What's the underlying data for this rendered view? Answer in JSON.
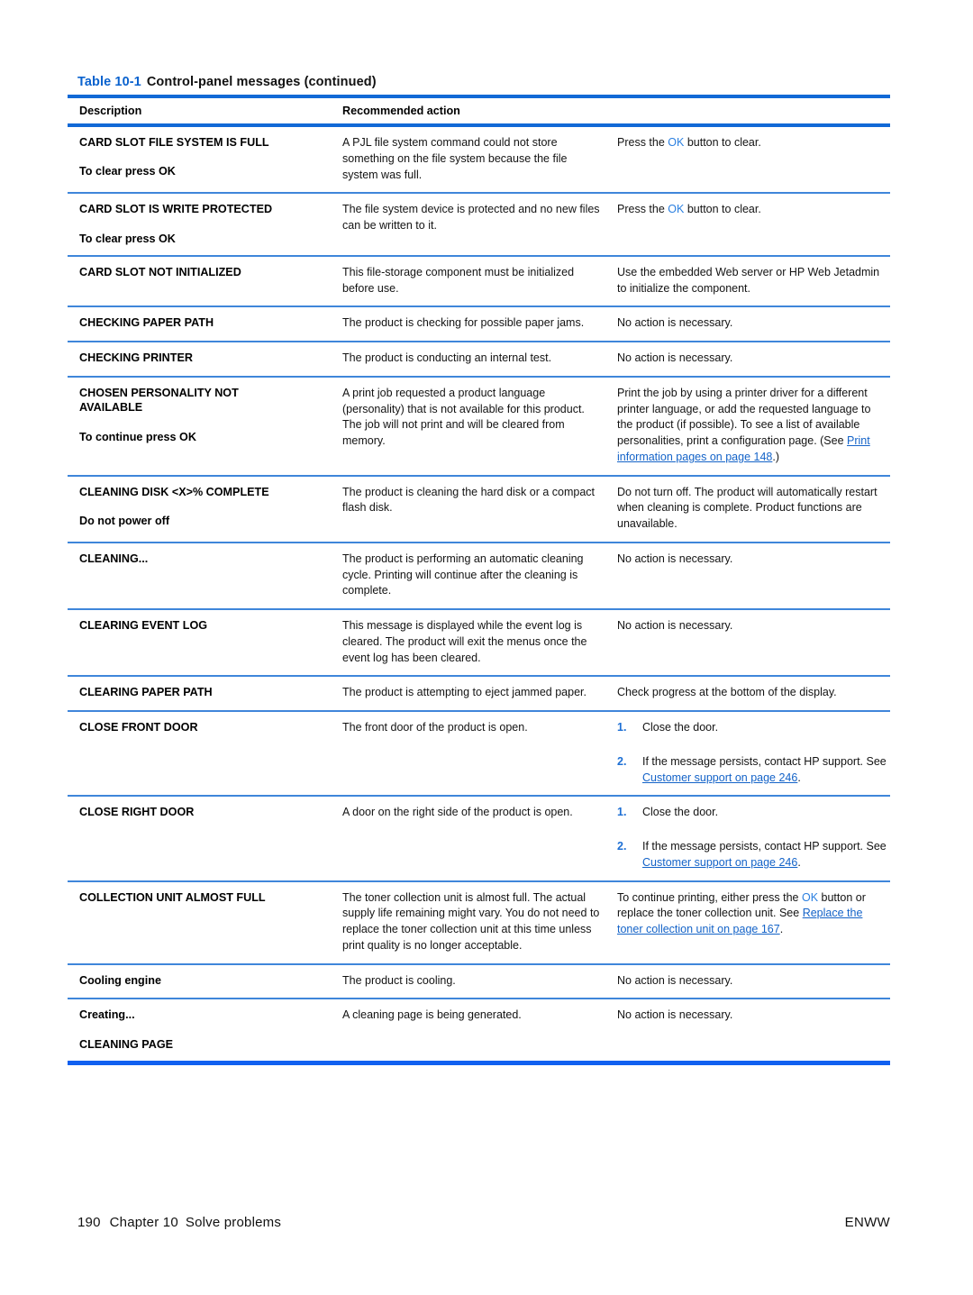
{
  "caption": {
    "label": "Table 10-1",
    "title": "Control-panel messages (continued)"
  },
  "table": {
    "headers": {
      "col1": "Description",
      "col2": "Recommended action"
    },
    "rows": [
      {
        "term": "CARD SLOT FILE SYSTEM IS FULL",
        "subterm": "To clear press OK",
        "description": "A PJL file system command could not store something on the file system because the file system was full.",
        "action_pre": "Press the ",
        "action_ok": "OK",
        "action_post": " button to clear."
      },
      {
        "term": "CARD SLOT IS WRITE PROTECTED",
        "subterm": "To clear press OK",
        "description": "The file system device is protected and no new files can be written to it.",
        "action_pre": "Press the ",
        "action_ok": "OK",
        "action_post": " button to clear."
      },
      {
        "term": "CARD SLOT NOT INITIALIZED",
        "subterm": "",
        "description": "This file-storage component must be initialized before use.",
        "action": "Use the embedded Web server or HP Web Jetadmin to initialize the component."
      },
      {
        "term": "CHECKING PAPER PATH",
        "subterm": "",
        "description": "The product is checking for possible paper jams.",
        "action": "No action is necessary."
      },
      {
        "term": "CHECKING PRINTER",
        "subterm": "",
        "description": "The product is conducting an internal test.",
        "action": "No action is necessary."
      },
      {
        "term": "CHOSEN PERSONALITY NOT AVAILABLE",
        "subterm": "To continue press OK",
        "description": "A print job requested a product language (personality) that is not available for this product. The job will not print and will be cleared from memory.",
        "action_pre": "Print the job by using a printer driver for a different printer language, or add the requested language to the product (if possible). To see a list of available personalities, print a configuration page. (See ",
        "action_link": "Print information pages on page 148",
        "action_post": ".)"
      },
      {
        "term": "CLEANING DISK <X>% COMPLETE",
        "subterm": "Do not power off",
        "description": "The product is cleaning the hard disk or a compact flash disk.",
        "action": "Do not turn off. The product will automatically restart when cleaning is complete. Product functions are unavailable."
      },
      {
        "term": "CLEANING...",
        "subterm": "",
        "description": "The product is performing an automatic cleaning cycle. Printing will continue after the cleaning is complete.",
        "action": "No action is necessary."
      },
      {
        "term": "CLEARING EVENT LOG",
        "subterm": "",
        "description": "This message is displayed while the event log is cleared. The product will exit the menus once the event log has been cleared.",
        "action": "No action is necessary."
      },
      {
        "term": "CLEARING PAPER PATH",
        "subterm": "",
        "description": "The product is attempting to eject jammed paper.",
        "action": "Check progress at the bottom of the display."
      },
      {
        "term": "CLOSE FRONT DOOR",
        "subterm": "",
        "description": "The front door of the product is open.",
        "steps": [
          {
            "num": "1.",
            "text": "Close the door."
          },
          {
            "num": "2.",
            "pre": "If the message persists, contact HP support. See ",
            "link": "Customer support on page 246",
            "post": "."
          }
        ]
      },
      {
        "term": "CLOSE RIGHT DOOR",
        "subterm": "",
        "description": "A door on the right side of the product is open.",
        "steps": [
          {
            "num": "1.",
            "text": "Close the door."
          },
          {
            "num": "2.",
            "pre": "If the message persists, contact HP support. See ",
            "link": "Customer support on page 246",
            "post": "."
          }
        ]
      },
      {
        "term": "COLLECTION UNIT ALMOST FULL",
        "subterm": "",
        "description": "The toner collection unit is almost full. The actual supply life remaining might vary. You do not need to replace the toner collection unit at this time unless print quality is no longer acceptable.",
        "action_pre": "To continue printing, either press the ",
        "action_ok": "OK",
        "action_mid": " button or replace the toner collection unit. See ",
        "action_link": "Replace the toner collection unit on page 167",
        "action_post": "."
      },
      {
        "term": "Cooling engine",
        "subterm": "",
        "description": "The product is cooling.",
        "action": "No action is necessary."
      },
      {
        "term": "Creating...",
        "subterm": "CLEANING PAGE",
        "description": "A cleaning page is being generated.",
        "action": "No action is necessary."
      }
    ]
  },
  "footer": {
    "page_number": "190",
    "chapter": "Chapter 10",
    "chapter_title": "Solve problems",
    "locale": "ENWW"
  },
  "colors": {
    "accent_blue": "#1169d6",
    "link_blue": "#1463c8",
    "ok_blue": "#2a7fe0"
  }
}
